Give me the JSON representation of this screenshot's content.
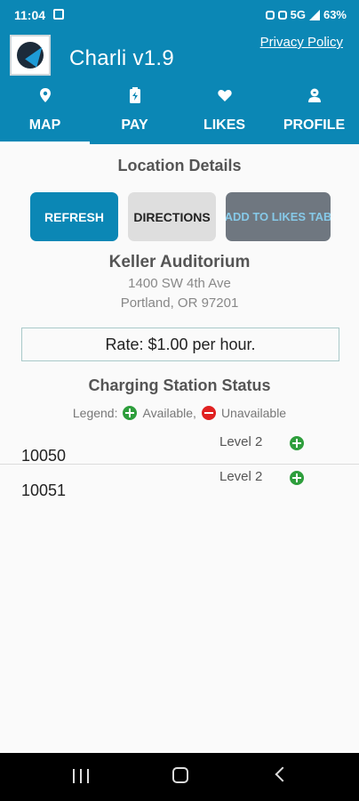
{
  "status_bar": {
    "time": "11:04",
    "network": "5G",
    "battery": "63%"
  },
  "app": {
    "title": "Charli v1.9",
    "privacy_link": "Privacy Policy"
  },
  "tabs": [
    {
      "label": "MAP",
      "icon": "map-pin-icon",
      "active": true
    },
    {
      "label": "PAY",
      "icon": "battery-icon",
      "active": false
    },
    {
      "label": "LIKES",
      "icon": "heart-icon",
      "active": false
    },
    {
      "label": "PROFILE",
      "icon": "person-icon",
      "active": false
    }
  ],
  "location_details": {
    "heading": "Location Details",
    "buttons": {
      "refresh": "REFRESH",
      "directions": "DIRECTIONS",
      "add_to_likes": "ADD TO LIKES TAB"
    },
    "venue_name": "Keller Auditorium",
    "address_line1": "1400 SW 4th Ave",
    "address_line2": "Portland, OR 97201",
    "rate": "Rate: $1.00 per hour."
  },
  "charging_status": {
    "heading": "Charging Station Status",
    "legend": {
      "prefix": "Legend:",
      "available": "Available,",
      "unavailable": "Unavailable"
    },
    "stations": [
      {
        "id": "10050",
        "level": "Level 2",
        "status": "available"
      },
      {
        "id": "10051",
        "level": "Level 2",
        "status": "available"
      }
    ]
  },
  "colors": {
    "primary": "#0b87b5",
    "available": "#2e9e3c",
    "unavailable": "#e02121"
  }
}
